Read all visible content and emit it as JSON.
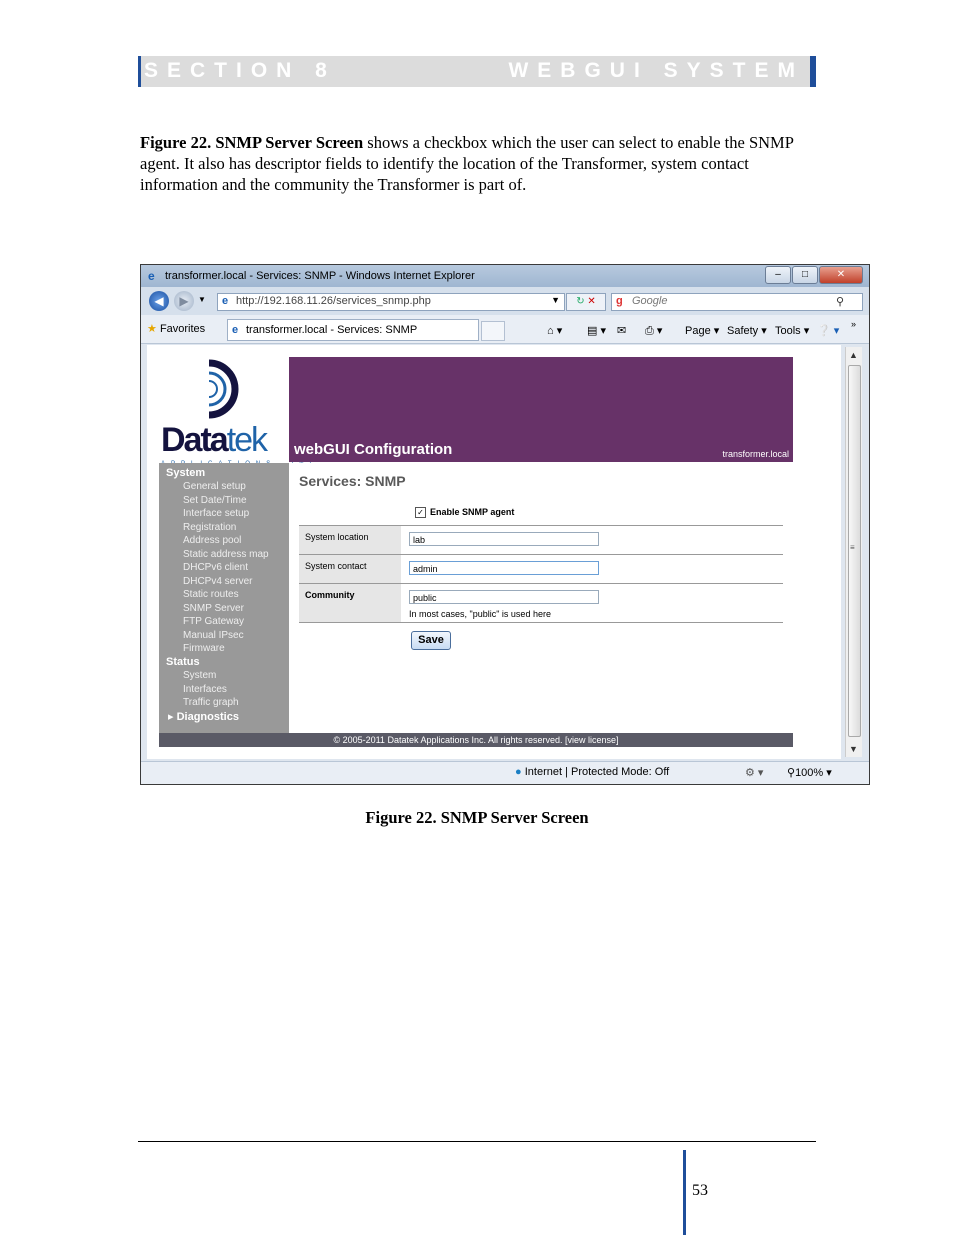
{
  "header": {
    "section": "SECTION 8",
    "title": "WEBGUI SYSTEM"
  },
  "intro": {
    "figure_ref": "Figure 22. SNMP Server Screen",
    "text": " shows a checkbox which the user can select to enable the SNMP agent.  It also has descriptor fields to identify the location of the Transformer, system contact information and the community the Transformer is part of."
  },
  "browser": {
    "window_title": "transformer.local - Services: SNMP - Windows Internet Explorer",
    "url": "http://192.168.11.26/services_snmp.php",
    "search_placeholder": "Google",
    "favorites_label": "Favorites",
    "tab_title": "transformer.local - Services: SNMP",
    "cmd_page": "Page",
    "cmd_safety": "Safety",
    "cmd_tools": "Tools",
    "status_zone": "Internet | Protected Mode: Off",
    "zoom": "100%"
  },
  "app": {
    "logo_word": "Data",
    "logo_word_suffix": "tek",
    "logo_sub": "APPLICATIONS, INC",
    "banner_title": "webGUI Configuration",
    "hostname": "transformer.local",
    "sidebar": {
      "system_label": "System",
      "system_items": [
        "General setup",
        "Set Date/Time",
        "Interface setup",
        "Registration",
        "Address pool",
        "Static address map",
        "DHCPv6 client",
        "DHCPv4 server",
        "Static routes",
        "SNMP Server",
        "FTP Gateway",
        "Manual IPsec",
        "Firmware"
      ],
      "status_label": "Status",
      "status_items": [
        "System",
        "Interfaces",
        "Traffic graph"
      ],
      "diagnostics_label": "Diagnostics"
    },
    "page_title": "Services: SNMP",
    "enable_label": "Enable SNMP agent",
    "fields": {
      "location_label": "System location",
      "location_value": "lab",
      "contact_label": "System contact",
      "contact_value": "admin",
      "community_label": "Community",
      "community_value": "public",
      "community_hint": "In most cases, \"public\" is used here"
    },
    "save_label": "Save",
    "footer": "© 2005-2011 Datatek Applications Inc. All rights reserved.  [view license]"
  },
  "caption": "Figure 22. SNMP Server Screen",
  "page_number": "53"
}
